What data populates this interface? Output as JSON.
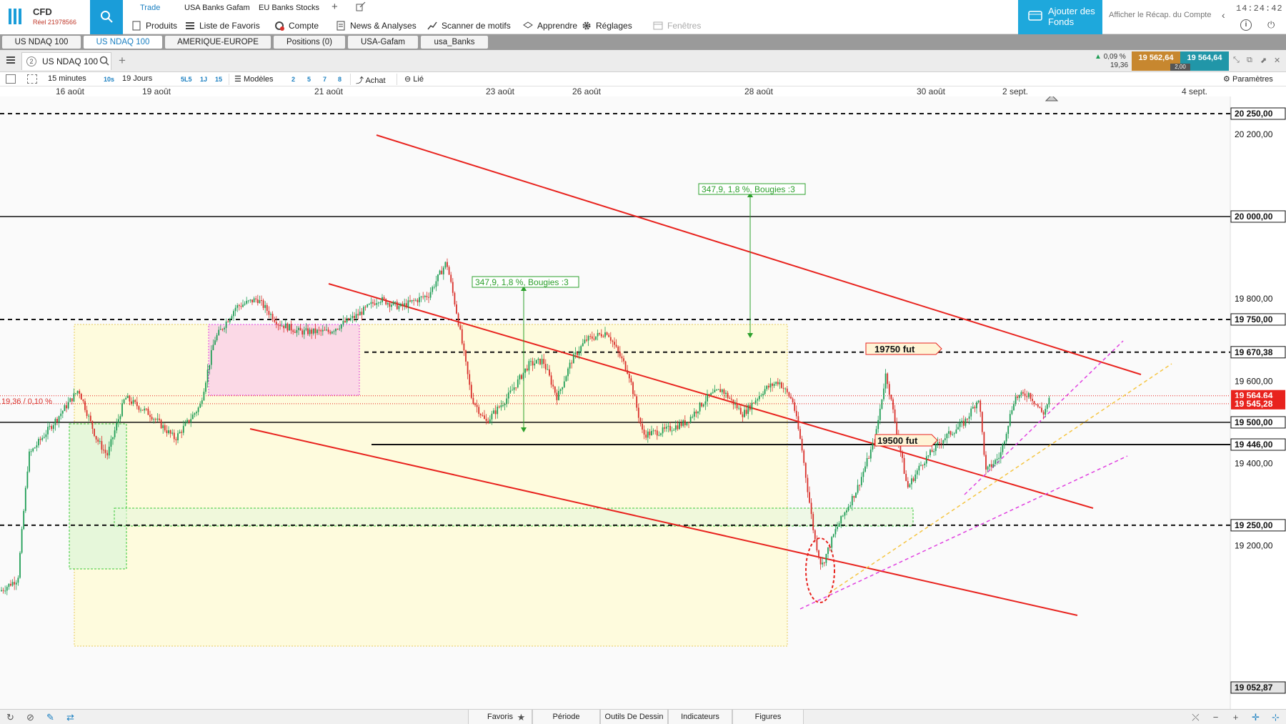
{
  "header": {
    "account_type": "CFD",
    "account_number": "Réel 21978566",
    "row1": [
      "Trade",
      "USA Banks Gafam",
      "EU Banks Stocks",
      "+"
    ],
    "menu": [
      {
        "label": "Produits",
        "icon": "product-icon"
      },
      {
        "label": "Liste de Favoris",
        "icon": "list-icon"
      },
      {
        "label": "Compte",
        "icon": "account-icon"
      },
      {
        "label": "News & Analyses",
        "icon": "news-icon"
      },
      {
        "label": "Scanner de motifs",
        "icon": "scanner-icon"
      },
      {
        "label": "Apprendre",
        "icon": "learn-icon"
      },
      {
        "label": "Réglages",
        "icon": "gear-icon"
      },
      {
        "label": "Fenêtres",
        "icon": "window-icon"
      }
    ],
    "fund_button": "Ajouter des Fonds",
    "recap_link": "Afficher le Récap. du Compte",
    "clock": "14:24:42"
  },
  "workspace_tabs": [
    "US NDAQ 100",
    "US NDAQ 100",
    "AMERIQUE-EUROPE",
    "Positions (0)",
    "USA-Gafam",
    "usa_Banks"
  ],
  "chart_tab": {
    "number": "2",
    "name": "US NDAQ 100"
  },
  "quote": {
    "change_pct": "0,09 %",
    "change_pts": "19,36",
    "bid": "19 562,64",
    "ask": "19 564,64",
    "spread": "2,00"
  },
  "toolbar": {
    "timeframe": "15 minutes",
    "tf_short": "10s",
    "range": "19 Jours",
    "range_short": [
      "5L5",
      "1J",
      "15"
    ],
    "models": "Modèles",
    "counts": [
      "2",
      "5",
      "7",
      "8"
    ],
    "buy": "Achat",
    "linked": "Lié",
    "settings": "Paramètres"
  },
  "date_axis": [
    "16 août",
    "19 août",
    "21 août",
    "23 août",
    "26 août",
    "28 août",
    "30 août",
    "2 sept.",
    "4 sept."
  ],
  "price_axis": [
    "20 250,00",
    "20 200,00",
    "20 000,00",
    "19 800,00",
    "19 750,00",
    "19 670,38",
    "19 600,00",
    "19 564,64",
    "19 545,28",
    "19 500,00",
    "19 446,00",
    "19 400,00",
    "19 250,00",
    "19 200,00",
    "19 052,87"
  ],
  "annotations": {
    "measure_top": "347,9, 1,8 %, Bougies :3",
    "measure_mid": "347,9, 1,8 %, Bougies :3",
    "fut_high": "19750  fut",
    "fut_low": "19500  fut",
    "left_change": "19,36 / 0,10 %"
  },
  "bottom_tabs": [
    "Favoris",
    "Période",
    "Outils De Dessin",
    "Indicateurs",
    "Figures"
  ],
  "colors": {
    "accent": "#1a9dd9",
    "trendline": "#e8231e",
    "bid": "#c7872f",
    "ask": "#2196a8",
    "price_up": "#1f9d55",
    "price_down": "#d9302b",
    "magenta": "#e040e0",
    "yellow_dashed": "#f5c542"
  },
  "chart_data": {
    "type": "candlestick",
    "instrument": "US NDAQ 100",
    "timeframe": "15 minutes",
    "x_range": [
      "16 août",
      "4 sept."
    ],
    "y_range": [
      19052.87,
      20250
    ],
    "last_price": 19564.64,
    "levels": [
      20250,
      20000,
      19750,
      19670.38,
      19564.64,
      19545.28,
      19500,
      19446,
      19250
    ],
    "horizontal_levels_dashed": [
      20250,
      19750,
      19670.38,
      19250
    ],
    "horizontal_levels_solid": [
      20000,
      19500,
      19446
    ]
  }
}
